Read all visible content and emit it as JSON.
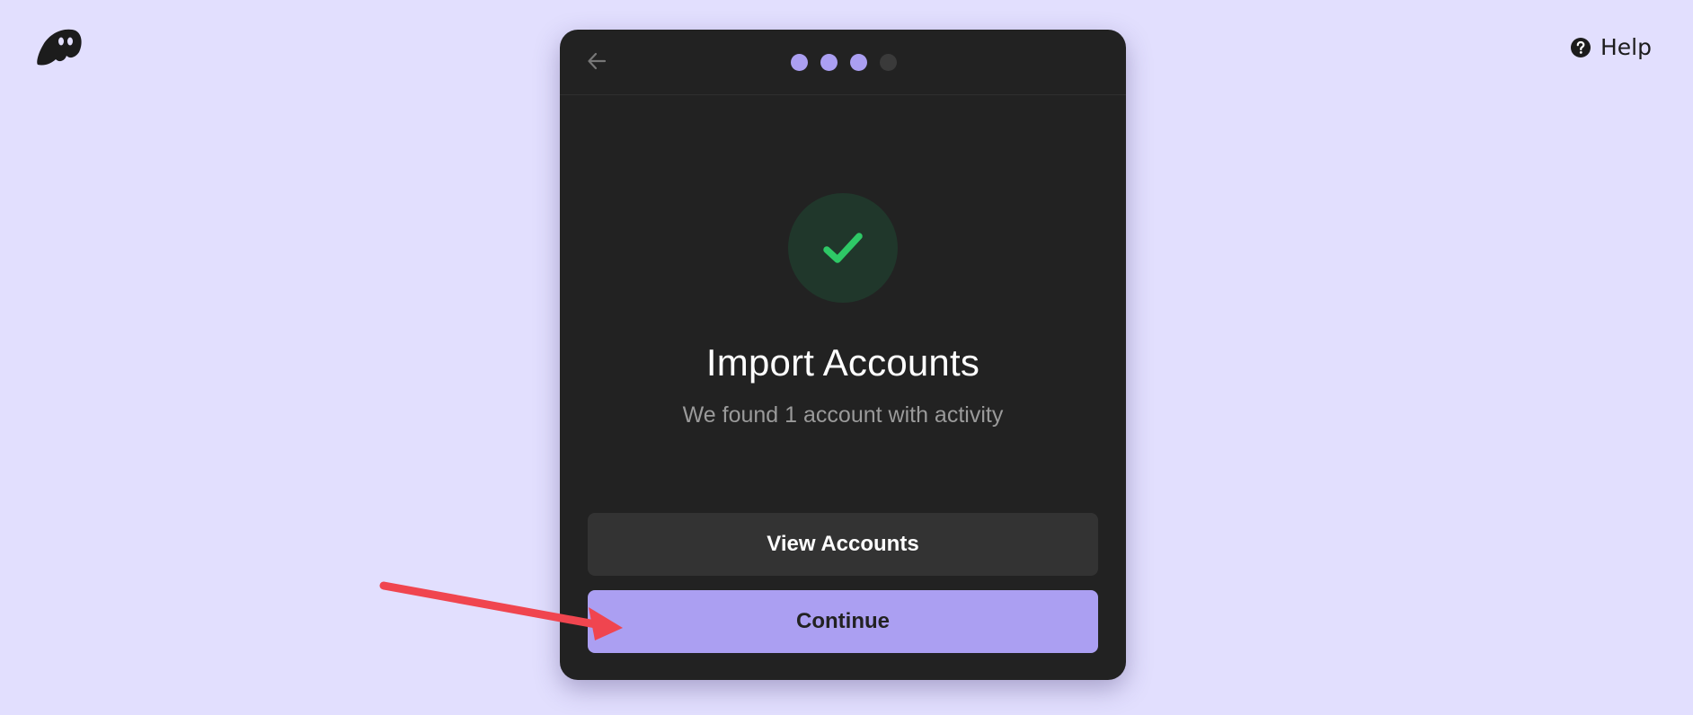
{
  "app": {
    "logo_icon": "phantom-ghost-icon",
    "help_label": "Help",
    "help_icon": "question-circle-icon"
  },
  "card": {
    "back_icon": "arrow-left-icon",
    "progress": {
      "total_steps": 4,
      "completed_steps": 3,
      "active_color": "#ab9ff2",
      "inactive_color": "#3a3a3a"
    },
    "status_icon": "checkmark-icon",
    "status_color": "#2ec866",
    "title": "Import Accounts",
    "subtitle": "We found 1 account with activity",
    "buttons": {
      "view_accounts": "View Accounts",
      "continue": "Continue"
    }
  },
  "colors": {
    "page_background": "#e2dffe",
    "card_background": "#222222",
    "accent": "#ab9ff2",
    "annotation_arrow": "#f0454f"
  }
}
